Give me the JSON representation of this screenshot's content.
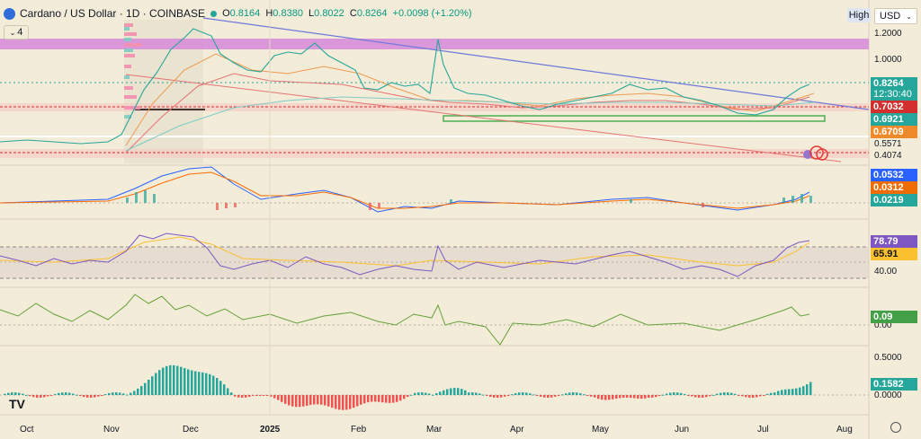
{
  "header": {
    "title": "Cardano / US Dollar · 1D · COINBASE",
    "ohlc": [
      {
        "k": "O",
        "v": "0.8164"
      },
      {
        "k": "H",
        "v": "0.8380"
      },
      {
        "k": "L",
        "v": "0.8022"
      },
      {
        "k": "C",
        "v": "0.8264"
      }
    ],
    "change": "+0.0098 (+1.20%)",
    "indicator_count": "4"
  },
  "controls": {
    "high_label": "High",
    "currency": "USD"
  },
  "price_axis": {
    "main": [
      "1.2000",
      "1.0000",
      "0.5571",
      "0.4074"
    ],
    "rsi": [
      "40.00"
    ],
    "osc": [
      "0.00"
    ],
    "ao": [
      "0.5000",
      "0.0000"
    ]
  },
  "tags": {
    "last_price": "0.8264",
    "countdown": "12:30:40",
    "level_red": "0.7032",
    "level_teal": "0.6921",
    "level_orange": "0.6709",
    "macd_blue": "0.0532",
    "macd_orange": "0.0312",
    "macd_hist": "0.0219",
    "rsi_value": "78.79",
    "rsi_ma": "65.91",
    "osc_value": "0.09",
    "ao_value": "0.1582"
  },
  "time_axis": [
    "Oct",
    "Nov",
    "Dec",
    "2025",
    "Feb",
    "Mar",
    "Apr",
    "May",
    "Jun",
    "Jul",
    "Aug"
  ],
  "colors": {
    "background": "#f2ecd9",
    "up": "#26a69a",
    "down": "#ef5350",
    "macd": "#2962ff",
    "signal": "#ff6d00",
    "rsi": "#7e57c2",
    "green_osc": "#43a047",
    "resistance_zone": "#d68ad9"
  }
}
